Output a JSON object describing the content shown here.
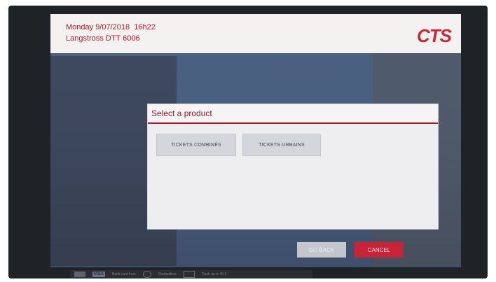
{
  "header": {
    "datetime": "Monday 9/07/2018  16h22",
    "station": "Langstross DTT 6006",
    "logo": "CTS"
  },
  "dialog": {
    "title": "Select a product",
    "products": [
      {
        "label": "TICKETS COMBINÉS"
      },
      {
        "label": "TICKETS URBAINS"
      }
    ]
  },
  "footer": {
    "go_back_label": "GO BACK",
    "cancel_label": "CANCEL"
  },
  "payment_strip": {
    "bank_card_text": "Bank card from",
    "contactless_text": "Contactless",
    "cash_text": "Cash up to 40 €",
    "visa_text": "VISA"
  },
  "colors": {
    "brand": "#c8283a",
    "accent_dark": "#a51a2c",
    "button_grey": "#d5d6dc",
    "cancel_red": "#c7243a"
  }
}
